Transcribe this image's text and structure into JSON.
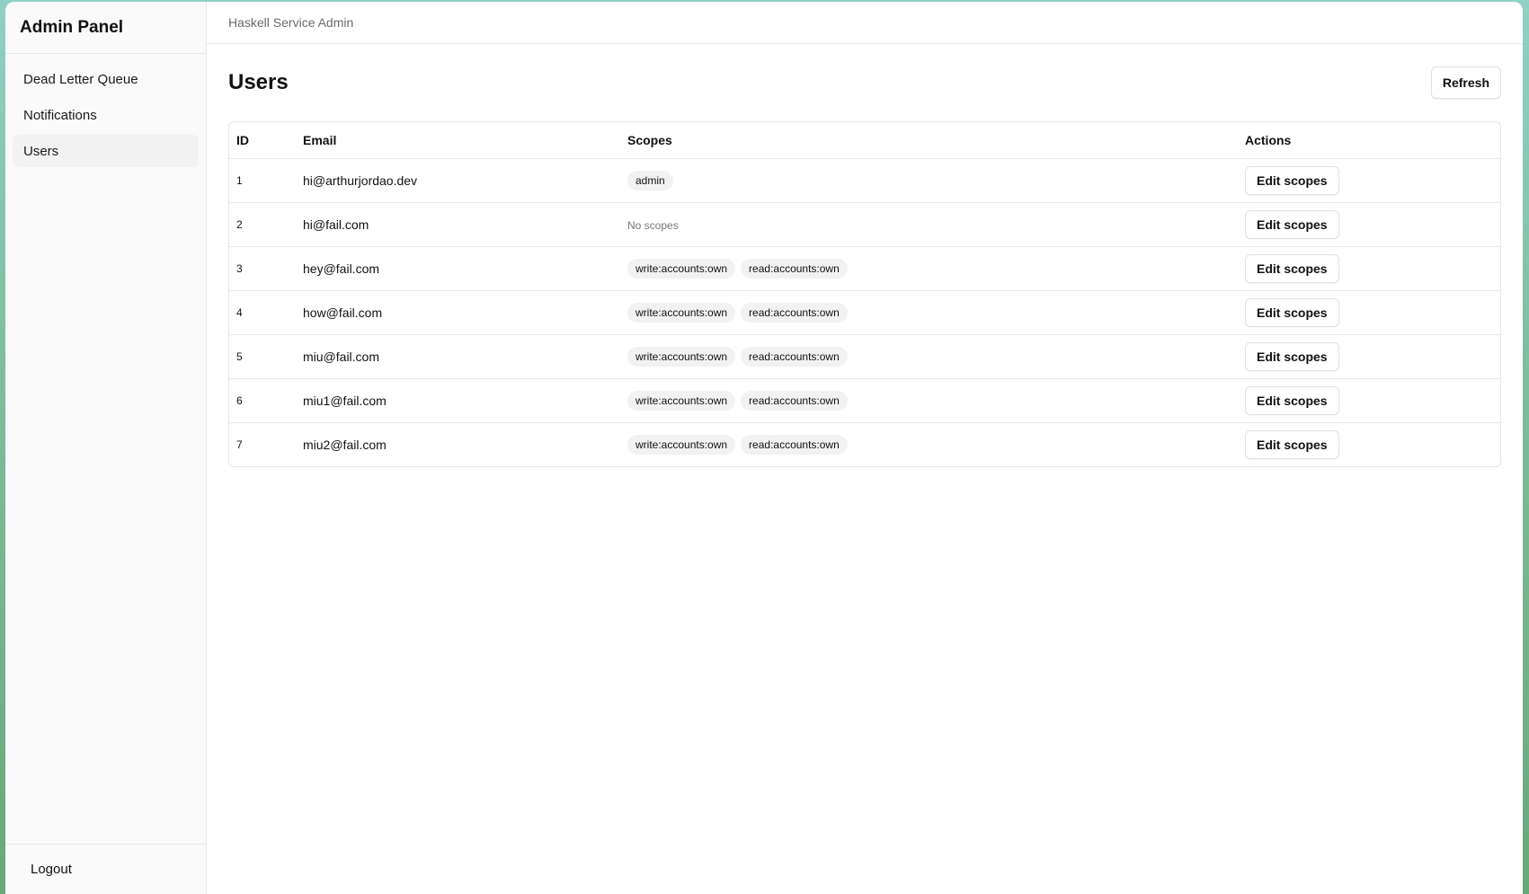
{
  "sidebar": {
    "title": "Admin Panel",
    "items": [
      {
        "label": "Dead Letter Queue"
      },
      {
        "label": "Notifications"
      },
      {
        "label": "Users"
      }
    ],
    "logout_label": "Logout"
  },
  "topbar": {
    "title": "Haskell Service Admin"
  },
  "page": {
    "title": "Users",
    "refresh_label": "Refresh"
  },
  "table": {
    "headers": {
      "id": "ID",
      "email": "Email",
      "scopes": "Scopes",
      "actions": "Actions"
    },
    "no_scopes_text": "No scopes",
    "action_label": "Edit scopes",
    "rows": [
      {
        "id": "1",
        "email": "hi@arthurjordao.dev",
        "scopes": [
          "admin"
        ]
      },
      {
        "id": "2",
        "email": "hi@fail.com",
        "scopes": []
      },
      {
        "id": "3",
        "email": "hey@fail.com",
        "scopes": [
          "write:accounts:own",
          "read:accounts:own"
        ]
      },
      {
        "id": "4",
        "email": "how@fail.com",
        "scopes": [
          "write:accounts:own",
          "read:accounts:own"
        ]
      },
      {
        "id": "5",
        "email": "miu@fail.com",
        "scopes": [
          "write:accounts:own",
          "read:accounts:own"
        ]
      },
      {
        "id": "6",
        "email": "miu1@fail.com",
        "scopes": [
          "write:accounts:own",
          "read:accounts:own"
        ]
      },
      {
        "id": "7",
        "email": "miu2@fail.com",
        "scopes": [
          "write:accounts:own",
          "read:accounts:own"
        ]
      }
    ]
  }
}
